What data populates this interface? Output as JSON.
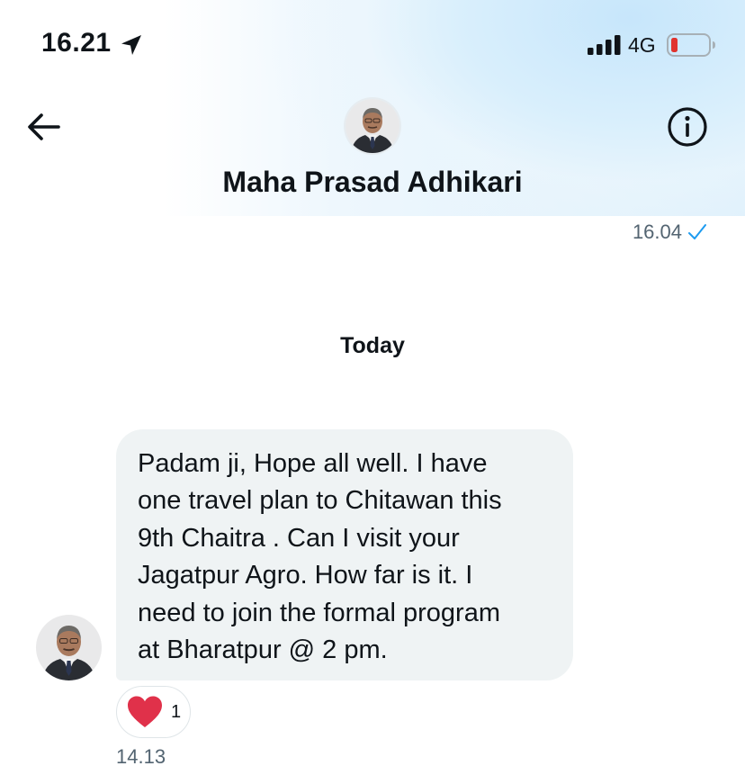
{
  "status_bar": {
    "time": "16.21",
    "network": "4G",
    "icons": [
      "location-arrow-icon",
      "signal-bars-icon",
      "battery-low-icon"
    ],
    "battery_color": "#e0342e"
  },
  "header": {
    "contact_name": "Maha Prasad Adhikari",
    "icons": [
      "back-arrow-icon",
      "info-icon"
    ]
  },
  "conversation": {
    "previous_message_time": "16.04",
    "previous_message_status_icon": "check-icon",
    "date_divider": "Today",
    "message": {
      "lines": [
        "Padam ji, Hope all well. I have",
        "one travel plan to Chitawan this",
        "9th Chaitra . Can I visit your",
        "Jagatpur Agro. How far is it. I",
        "need to join the formal program",
        "at Bharatpur @ 2 pm."
      ],
      "reaction": {
        "icon": "heart-icon",
        "count": "1",
        "color": "#e0314a"
      },
      "time": "14.13"
    }
  },
  "colors": {
    "text_primary": "#0f1419",
    "text_secondary": "#536471",
    "bubble_bg": "#eff3f4",
    "accent": "#1d9bf0"
  }
}
